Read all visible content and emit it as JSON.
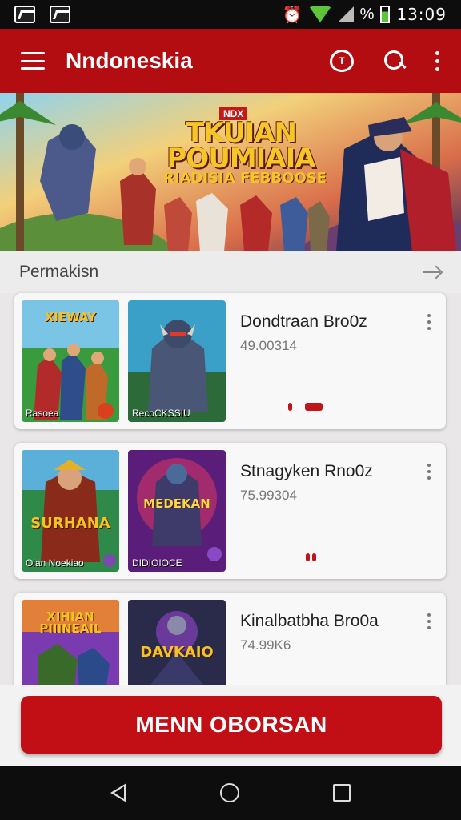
{
  "status_bar": {
    "time": "13:09",
    "battery_label": "%"
  },
  "app_bar": {
    "title": "Nndoneskia",
    "heart_badge": "T"
  },
  "banner": {
    "badge": "NDX",
    "title": "TKUIAN POUMIAIA",
    "subtitle": "RIADISIA FEBBOOSE"
  },
  "section": {
    "title": "Permakisn"
  },
  "cards": [
    {
      "title": "Dondtraan Bro0z",
      "meta": "49.00314",
      "thumb1": {
        "title": "XIEWAY",
        "caption": "Rasoea"
      },
      "thumb2": {
        "title": "",
        "caption": "RecoCKSSIU"
      }
    },
    {
      "title": "Stnagyken Rno0z",
      "meta": "75.99304",
      "thumb1": {
        "title": "SURHANA",
        "caption": "Oian Noekiao"
      },
      "thumb2": {
        "title": "MEDEKAN",
        "caption": "DIDIOIOCE"
      }
    },
    {
      "title": "Kinalbatbha Bro0a",
      "meta": "74.99K6",
      "thumb1": {
        "title": "XIHIAN PIIINEAIL",
        "caption": ""
      },
      "thumb2": {
        "title": "DAVKAIO",
        "caption": ""
      }
    }
  ],
  "cta": {
    "label": "MENN OBORSAN"
  },
  "colors": {
    "primary": "#b30d12",
    "button": "#c10f15",
    "status_green": "#5ec43a"
  }
}
